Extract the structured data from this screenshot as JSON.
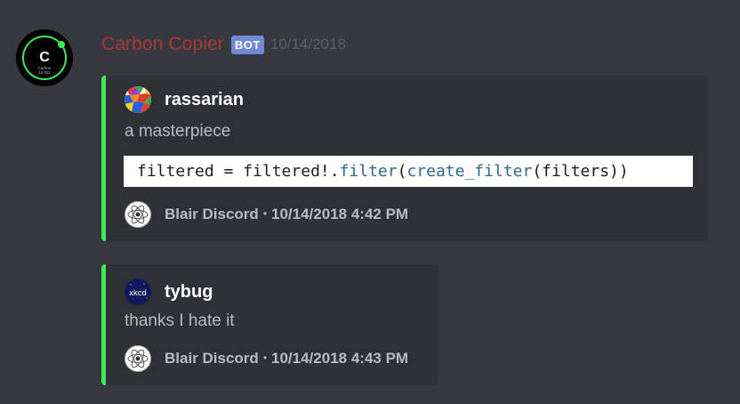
{
  "message": {
    "author": "Carbon Copier",
    "bot_tag": "BOT",
    "timestamp": "10/14/2018",
    "avatar": {
      "letter": "C",
      "caption_line1": "Carbon",
      "caption_line2": "12.011",
      "icon": "carbon-element-badge"
    }
  },
  "embeds": [
    {
      "author": "rassarian",
      "description": "a masterpiece",
      "code": {
        "part1": "filtered = filtered!.",
        "method1": "filter",
        "part2": "(",
        "method2": "create_filter",
        "part3": "(filters))"
      },
      "footer": {
        "source": "Blair Discord",
        "separator": "•",
        "datetime": "10/14/2018 4:42 PM"
      },
      "accent_color": "#3eea59"
    },
    {
      "author": "tybug",
      "author_avatar_text": "xkcd",
      "description": "thanks I hate it",
      "footer": {
        "source": "Blair Discord",
        "separator": "•",
        "datetime": "10/14/2018 4:43 PM"
      },
      "accent_color": "#3eea59"
    }
  ],
  "colors": {
    "background": "#36393f",
    "embed_background": "#2f3136",
    "username": "#a83a36",
    "bot_tag": "#7289da",
    "timestamp": "#5d6066",
    "text_muted": "#b9bbbe"
  }
}
